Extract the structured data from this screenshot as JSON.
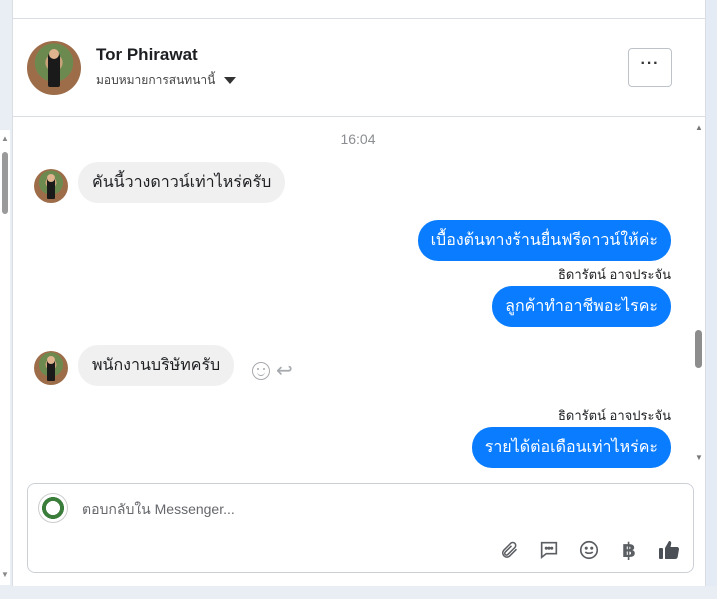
{
  "header": {
    "contact_name": "Tor Phirawat",
    "assign_label": "มอบหมายการสนทนานี้",
    "more_label": "···"
  },
  "thread": {
    "timestamp": "16:04",
    "messages": [
      {
        "direction": "in",
        "text": "คันนี้วางดาวน์เท่าไหร่ครับ"
      },
      {
        "direction": "out",
        "text": "เบื้องต้นทางร้านยื่นฟรีดาวน์ให้ค่ะ"
      },
      {
        "direction": "out",
        "sender": "ธิดารัตน์ อาจประจัน",
        "text": "ลูกค้าทำอาชีพอะไรคะ"
      },
      {
        "direction": "in",
        "text": "พนักงานบริษัทครับ"
      },
      {
        "direction": "out",
        "sender": "ธิดารัตน์ อาจประจัน",
        "text": "รายได้ต่อเดือนเท่าไหร่คะ"
      }
    ]
  },
  "composer": {
    "placeholder": "ตอบกลับใน Messenger...",
    "baht_symbol": "฿",
    "icons": [
      "paperclip-icon",
      "speech-bubble-icon",
      "smile-icon",
      "baht-icon",
      "thumbs-up-icon"
    ]
  },
  "colors": {
    "outgoing_bubble": "#0a7cff",
    "incoming_bubble": "#f0f0f0"
  }
}
